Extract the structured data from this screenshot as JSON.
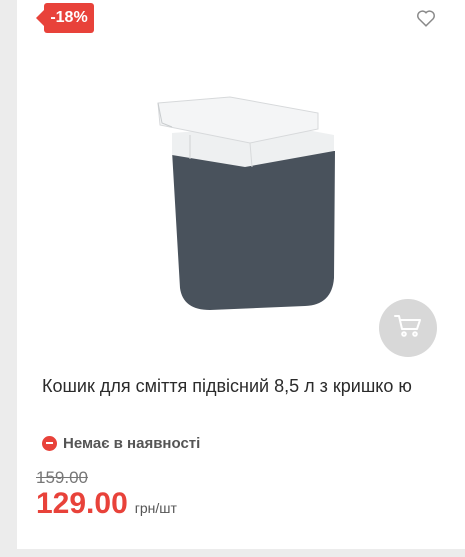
{
  "product": {
    "discount_badge": "-18%",
    "title": "Кошик для сміття підвісний 8,5 л з кришко ю",
    "stock_status": "Немає в наявності",
    "old_price": "159.00",
    "price": "129.00",
    "unit": "грн/шт"
  },
  "icons": {
    "favorite": "heart-outline-icon",
    "cart": "shopping-cart-icon",
    "stock": "minus-circle-icon"
  },
  "colors": {
    "accent": "#e8423a",
    "cart_button_bg": "#d8d8d8"
  }
}
